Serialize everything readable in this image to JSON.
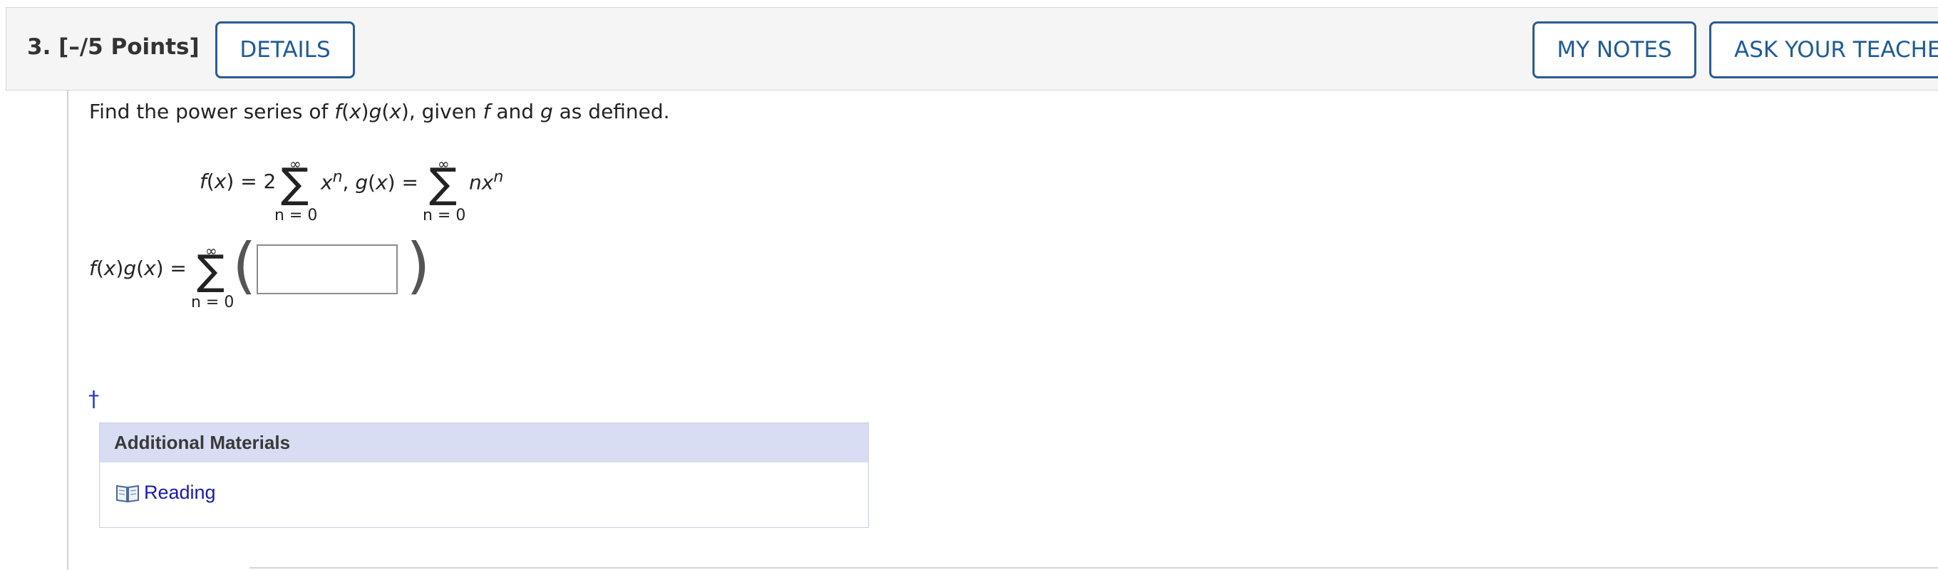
{
  "header": {
    "question_number": "3.",
    "points": "[–/5 Points]",
    "details_label": "DETAILS",
    "my_notes_label": "MY NOTES",
    "ask_teacher_label": "ASK YOUR TEACHE"
  },
  "question": {
    "prompt_parts": [
      "Find the power series of ",
      "f",
      "(",
      "x",
      ")",
      "g",
      "(",
      "x",
      "), given ",
      "f",
      " and ",
      "g",
      " as defined."
    ],
    "definitions": {
      "f_lhs": "f",
      "x": "x",
      "eq_two": ") = 2",
      "sigma": "∑",
      "infinity": "∞",
      "lower_limit": "n = 0",
      "xn_base": "x",
      "n_exp": "n",
      "comma": ", ",
      "g_lhs": "g",
      "eq": ") =",
      "nx_n": "n",
      "nx_x": "x"
    },
    "answer": {
      "lhs_f": "f",
      "lhs_g": "g",
      "lhs_x": "x",
      "lhs_eq": ") =",
      "value": ""
    },
    "dagger": "†"
  },
  "additional_materials": {
    "title": "Additional Materials",
    "items": [
      {
        "label": "Reading",
        "icon": "book-icon"
      }
    ]
  }
}
